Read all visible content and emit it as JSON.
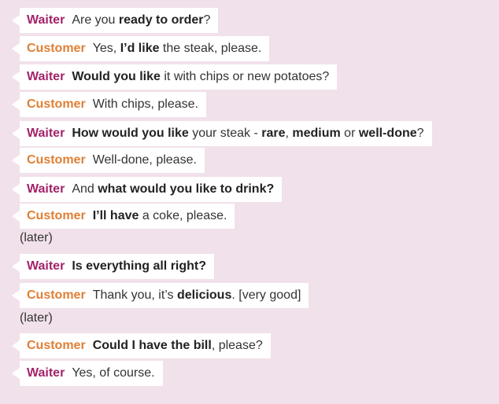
{
  "dialogue": [
    {
      "speaker": "Waiter",
      "parts": [
        {
          "t": "Are you "
        },
        {
          "t": "ready to order",
          "b": true
        },
        {
          "t": "?"
        }
      ]
    },
    {
      "speaker": "Customer",
      "parts": [
        {
          "t": "Yes, "
        },
        {
          "t": "I’d like",
          "b": true
        },
        {
          "t": " the steak, please."
        }
      ]
    },
    {
      "speaker": "Waiter",
      "parts": [
        {
          "t": "Would you like",
          "b": true
        },
        {
          "t": " it with chips or new potatoes?"
        }
      ]
    },
    {
      "speaker": "Customer",
      "parts": [
        {
          "t": "With chips, please."
        }
      ]
    },
    {
      "speaker": "Waiter",
      "parts": [
        {
          "t": "How would you like",
          "b": true
        },
        {
          "t": " your steak - "
        },
        {
          "t": "rare",
          "b": true
        },
        {
          "t": ", "
        },
        {
          "t": "medium",
          "b": true
        },
        {
          "t": " or "
        },
        {
          "t": "well-done",
          "b": true
        },
        {
          "t": "?"
        }
      ]
    },
    {
      "speaker": "Customer",
      "parts": [
        {
          "t": "Well-done, please."
        }
      ]
    },
    {
      "speaker": "Waiter",
      "parts": [
        {
          "t": "And "
        },
        {
          "t": "what would you like to drink?",
          "b": true
        }
      ]
    },
    {
      "speaker": "Customer",
      "parts": [
        {
          "t": "I’ll have",
          "b": true
        },
        {
          "t": " a coke, please."
        }
      ]
    },
    {
      "type": "note",
      "text": "(later)"
    },
    {
      "speaker": "Waiter",
      "parts": [
        {
          "t": "Is everything all right?",
          "b": true
        }
      ]
    },
    {
      "speaker": "Customer",
      "parts": [
        {
          "t": "Thank you, it’s "
        },
        {
          "t": "delicious",
          "b": true
        },
        {
          "t": ". [very good]"
        }
      ]
    },
    {
      "type": "note",
      "text": "(later)"
    },
    {
      "speaker": "Customer",
      "parts": [
        {
          "t": "Could I have the bill",
          "b": true
        },
        {
          "t": ", please?"
        }
      ]
    },
    {
      "speaker": "Waiter",
      "parts": [
        {
          "t": "Yes, of course."
        }
      ]
    }
  ],
  "colors": {
    "background": "#f1e1ea",
    "waiter": "#a3236a",
    "customer": "#e07f35",
    "bubble": "#ffffff"
  }
}
